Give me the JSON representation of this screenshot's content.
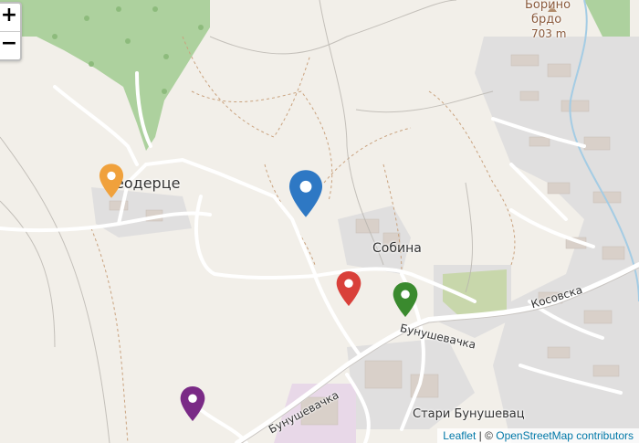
{
  "zoom": {
    "in_label": "+",
    "out_label": "−"
  },
  "attribution": {
    "leaflet": "Leaflet",
    "separator": " | © ",
    "osm": "OpenStreetMap contributors"
  },
  "places": {
    "borino": "Борино",
    "brdo": "брдо",
    "elevation": "703 m",
    "odertse": "еодерце",
    "sobina": "Собина",
    "kosovska": "Косовска",
    "bunushevachka_1": "Бунушевачка",
    "bunushevachka_2": "Бунушевачка",
    "stari": "Стари Бунушевац"
  },
  "markers": [
    {
      "name": "orange-marker",
      "color": "#f0a13c"
    },
    {
      "name": "blue-marker",
      "color": "#2e78c4"
    },
    {
      "name": "red-marker",
      "color": "#d9403a"
    },
    {
      "name": "green-marker",
      "color": "#3a8a2e"
    },
    {
      "name": "purple-marker",
      "color": "#7a2a86"
    }
  ]
}
